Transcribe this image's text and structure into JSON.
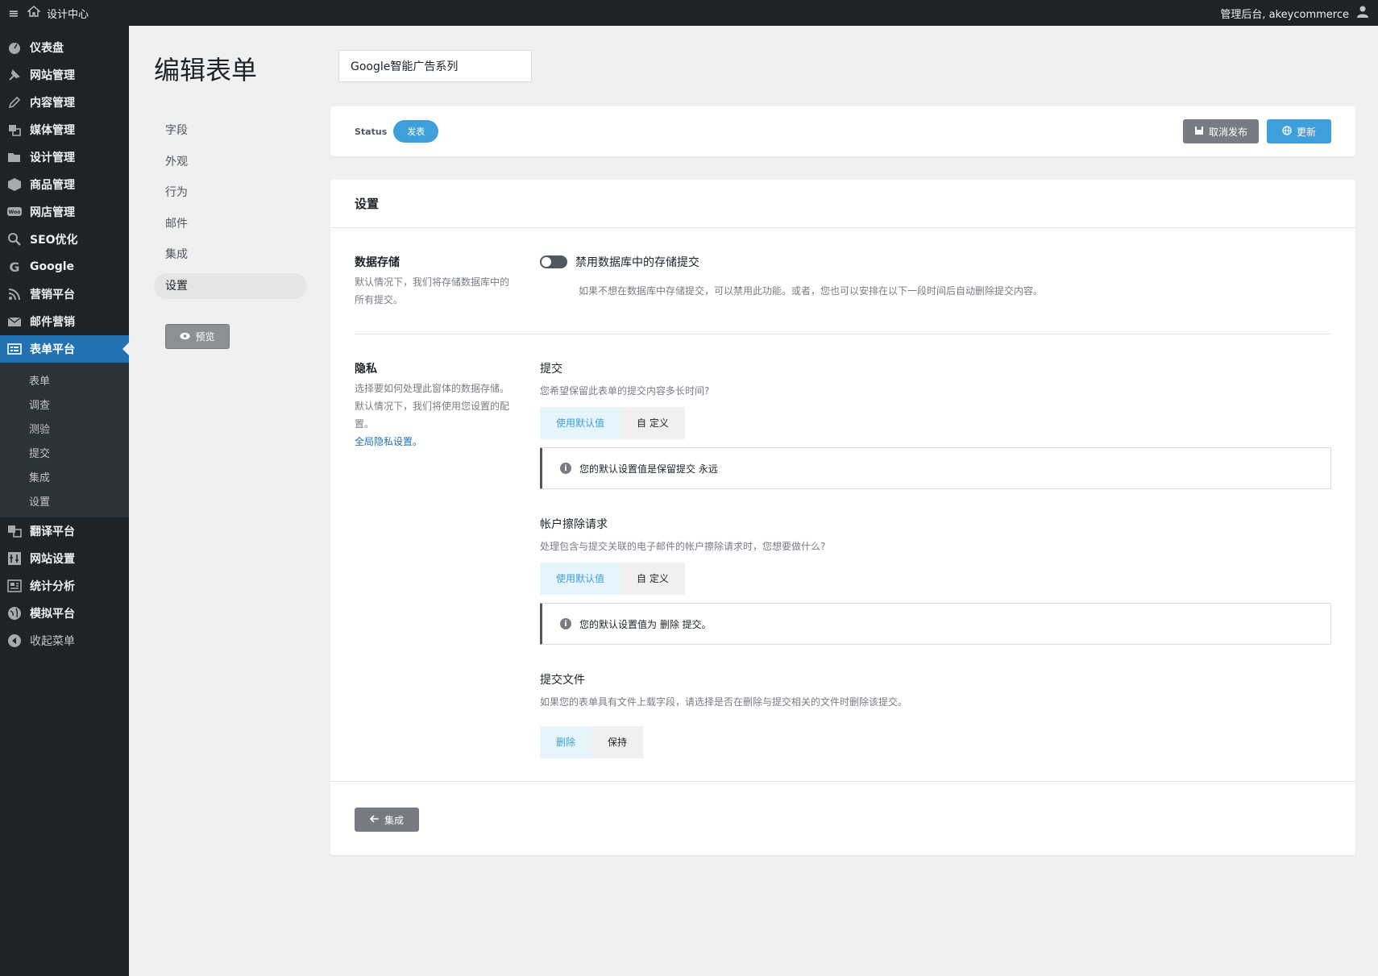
{
  "topbar": {
    "site_name": "设计中心",
    "greeting": "管理后台, akeycommerce"
  },
  "sidebar": {
    "items": [
      {
        "label": "仪表盘",
        "icon": "dashboard-icon"
      },
      {
        "label": "网站管理",
        "icon": "pin-icon"
      },
      {
        "label": "内容管理",
        "icon": "pencil-icon"
      },
      {
        "label": "媒体管理",
        "icon": "media-icon"
      },
      {
        "label": "设计管理",
        "icon": "folder-icon"
      },
      {
        "label": "商品管理",
        "icon": "box-icon"
      },
      {
        "label": "网店管理",
        "icon": "woo-icon"
      },
      {
        "label": "SEO优化",
        "icon": "search-icon"
      },
      {
        "label": "Google",
        "icon": "google-icon"
      },
      {
        "label": "营销平台",
        "icon": "rss-icon"
      },
      {
        "label": "邮件营销",
        "icon": "mail-icon"
      },
      {
        "label": "表单平台",
        "icon": "form-icon"
      }
    ],
    "submenu": [
      "表单",
      "调查",
      "测验",
      "提交",
      "集成",
      "设置"
    ],
    "items_after": [
      {
        "label": "翻译平台",
        "icon": "translate-icon"
      },
      {
        "label": "网站设置",
        "icon": "settings-icon"
      },
      {
        "label": "统计分析",
        "icon": "analytics-icon"
      },
      {
        "label": "模拟平台",
        "icon": "globe-icon"
      }
    ],
    "collapse": "收起菜单"
  },
  "page": {
    "title": "编辑表单",
    "form_name": "Google智能广告系列"
  },
  "subnav": {
    "tabs": [
      "字段",
      "外观",
      "行为",
      "邮件",
      "集成",
      "设置"
    ],
    "active": "设置",
    "preview": "预览"
  },
  "status": {
    "label": "Status",
    "badge": "发表",
    "unpublish": "取消发布",
    "update": "更新"
  },
  "settings": {
    "header": "设置",
    "storage": {
      "title": "数据存储",
      "desc": "默认情况下，我们将存储数据库中的所有提交。",
      "toggle_label": "禁用数据库中的存储提交",
      "toggle_hint": "如果不想在数据库中存储提交，可以禁用此功能。或者，您也可以安排在以下一段时间后自动删除提交内容。"
    },
    "privacy": {
      "title": "隐私",
      "desc1": "选择要如何处理此窗体的数据存储。",
      "desc2": "默认情况下，我们将使用您设置的配置。",
      "link": "全局隐私设置。",
      "submissions": {
        "title": "提交",
        "hint": "您希望保留此表单的提交内容多长时间?",
        "opt_default": "使用默认值",
        "opt_custom": "自 定义",
        "notice": "您的默认设置值是保留提交 永远"
      },
      "erasure": {
        "title": "帐户擦除请求",
        "hint": "处理包含与提交关联的电子邮件的帐户擦除请求时，您想要做什么?",
        "opt_default": "使用默认值",
        "opt_custom": "自 定义",
        "notice": "您的默认设置值为 删除 提交。"
      },
      "files": {
        "title": "提交文件",
        "hint": "如果您的表单具有文件上载字段，请选择是否在删除与提交相关的文件时删除该提交。",
        "opt_delete": "删除",
        "opt_keep": "保持"
      }
    },
    "back": "集成"
  }
}
